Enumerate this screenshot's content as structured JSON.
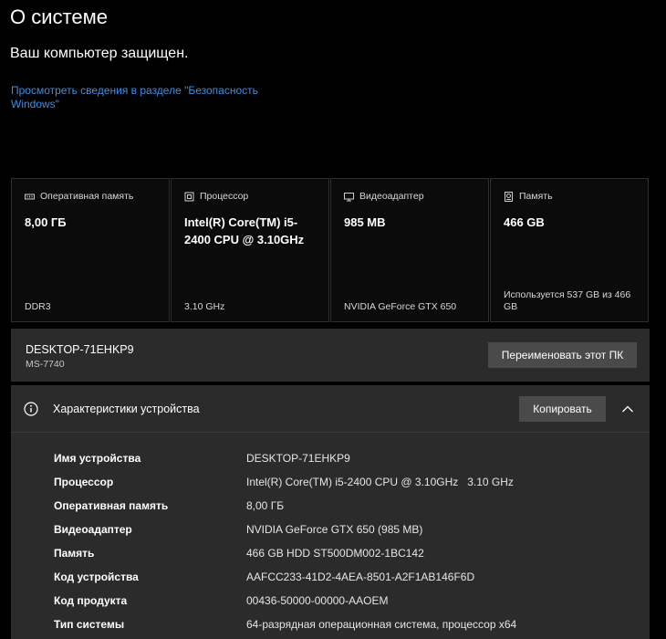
{
  "page": {
    "title": "О системе",
    "protection_status": "Ваш компьютер защищен.",
    "security_link": "Просмотреть сведения в разделе \"Безопасность Windows\""
  },
  "cards": [
    {
      "icon": "memory-icon",
      "label": "Оперативная память",
      "value": "8,00 ГБ",
      "footer": "DDR3"
    },
    {
      "icon": "processor-icon",
      "label": "Процессор",
      "value": "Intel(R) Core(TM) i5-2400 CPU @ 3.10GHz",
      "footer": "3.10 GHz"
    },
    {
      "icon": "display-adapter-icon",
      "label": "Видеоадаптер",
      "value": "985 MB",
      "footer": "NVIDIA GeForce GTX 650"
    },
    {
      "icon": "storage-icon",
      "label": "Память",
      "value": "466 GB",
      "footer": "Используется 537 GB из 466 GB"
    }
  ],
  "pc": {
    "name": "DESKTOP-71EHKP9",
    "model": "MS-7740",
    "rename_button": "Переименовать этот ПК"
  },
  "specs": {
    "title": "Характеристики устройства",
    "copy_button": "Копировать",
    "rows": [
      {
        "label": "Имя устройства",
        "value": "DESKTOP-71EHKP9"
      },
      {
        "label": "Процессор",
        "value": "Intel(R) Core(TM) i5-2400 CPU @ 3.10GHz   3.10 GHz"
      },
      {
        "label": "Оперативная память",
        "value": "8,00 ГБ"
      },
      {
        "label": "Видеоадаптер",
        "value": "NVIDIA GeForce GTX 650 (985 MB)"
      },
      {
        "label": "Память",
        "value": "466 GB HDD ST500DM002-1BC142"
      },
      {
        "label": "Код устройства",
        "value": "AAFCC233-41D2-4AEA-8501-A2F1AB146F6D"
      },
      {
        "label": "Код продукта",
        "value": "00436-50000-00000-AAOEM"
      },
      {
        "label": "Тип системы",
        "value": "64-разрядная операционная система, процессор x64"
      }
    ]
  },
  "colors": {
    "background": "#000000",
    "panel": "#2b2b2b",
    "button": "#4a4a4a",
    "link": "#3a8fe8"
  }
}
